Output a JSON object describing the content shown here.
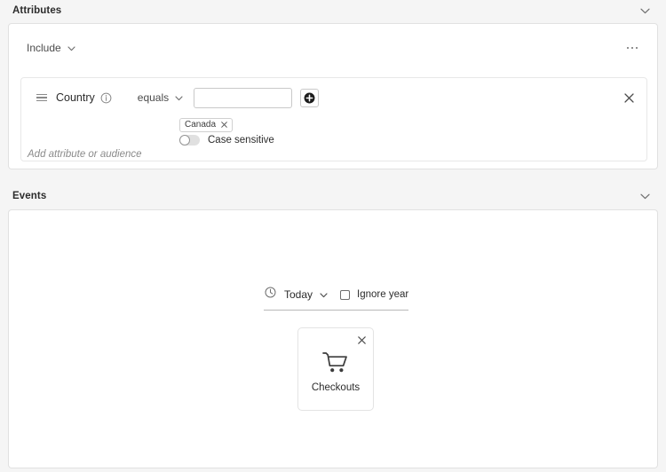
{
  "sections": {
    "attributes": {
      "title": "Attributes",
      "collapse_icon": "chevron-down-icon",
      "logic": {
        "selected": "Include",
        "caret_icon": "chevron-down-icon"
      },
      "more_options_icon": "overflow-menu-icon",
      "condition": {
        "drag_icon": "drag-handle-icon",
        "attribute_name": "Country",
        "info_icon": "info-icon",
        "operator": "equals",
        "operator_caret_icon": "chevron-down-icon",
        "value_input": "",
        "value_placeholder": "",
        "add_value_icon": "add-circle-icon",
        "remove_icon": "close-icon",
        "tags": [
          {
            "label": "Canada",
            "remove_icon": "close-icon"
          }
        ],
        "case_sensitive": {
          "label": "Case sensitive",
          "enabled": false
        }
      },
      "add_row_placeholder": "Add attribute or audience"
    },
    "events": {
      "title": "Events",
      "collapse_icon": "chevron-down-icon",
      "timeframe": {
        "clock_icon": "clock-icon",
        "selected": "Today",
        "caret_icon": "chevron-down-icon",
        "ignore_year": {
          "label": "Ignore year",
          "checked": false
        }
      },
      "cards": [
        {
          "label": "Checkouts",
          "icon": "shopping-cart-icon",
          "remove_icon": "close-icon"
        }
      ]
    }
  },
  "colors": {
    "background": "#f5f5f5",
    "panel": "#ffffff",
    "border": "#e1e1e1",
    "text": "#2c2c2c",
    "muted": "#8b8b8b"
  }
}
